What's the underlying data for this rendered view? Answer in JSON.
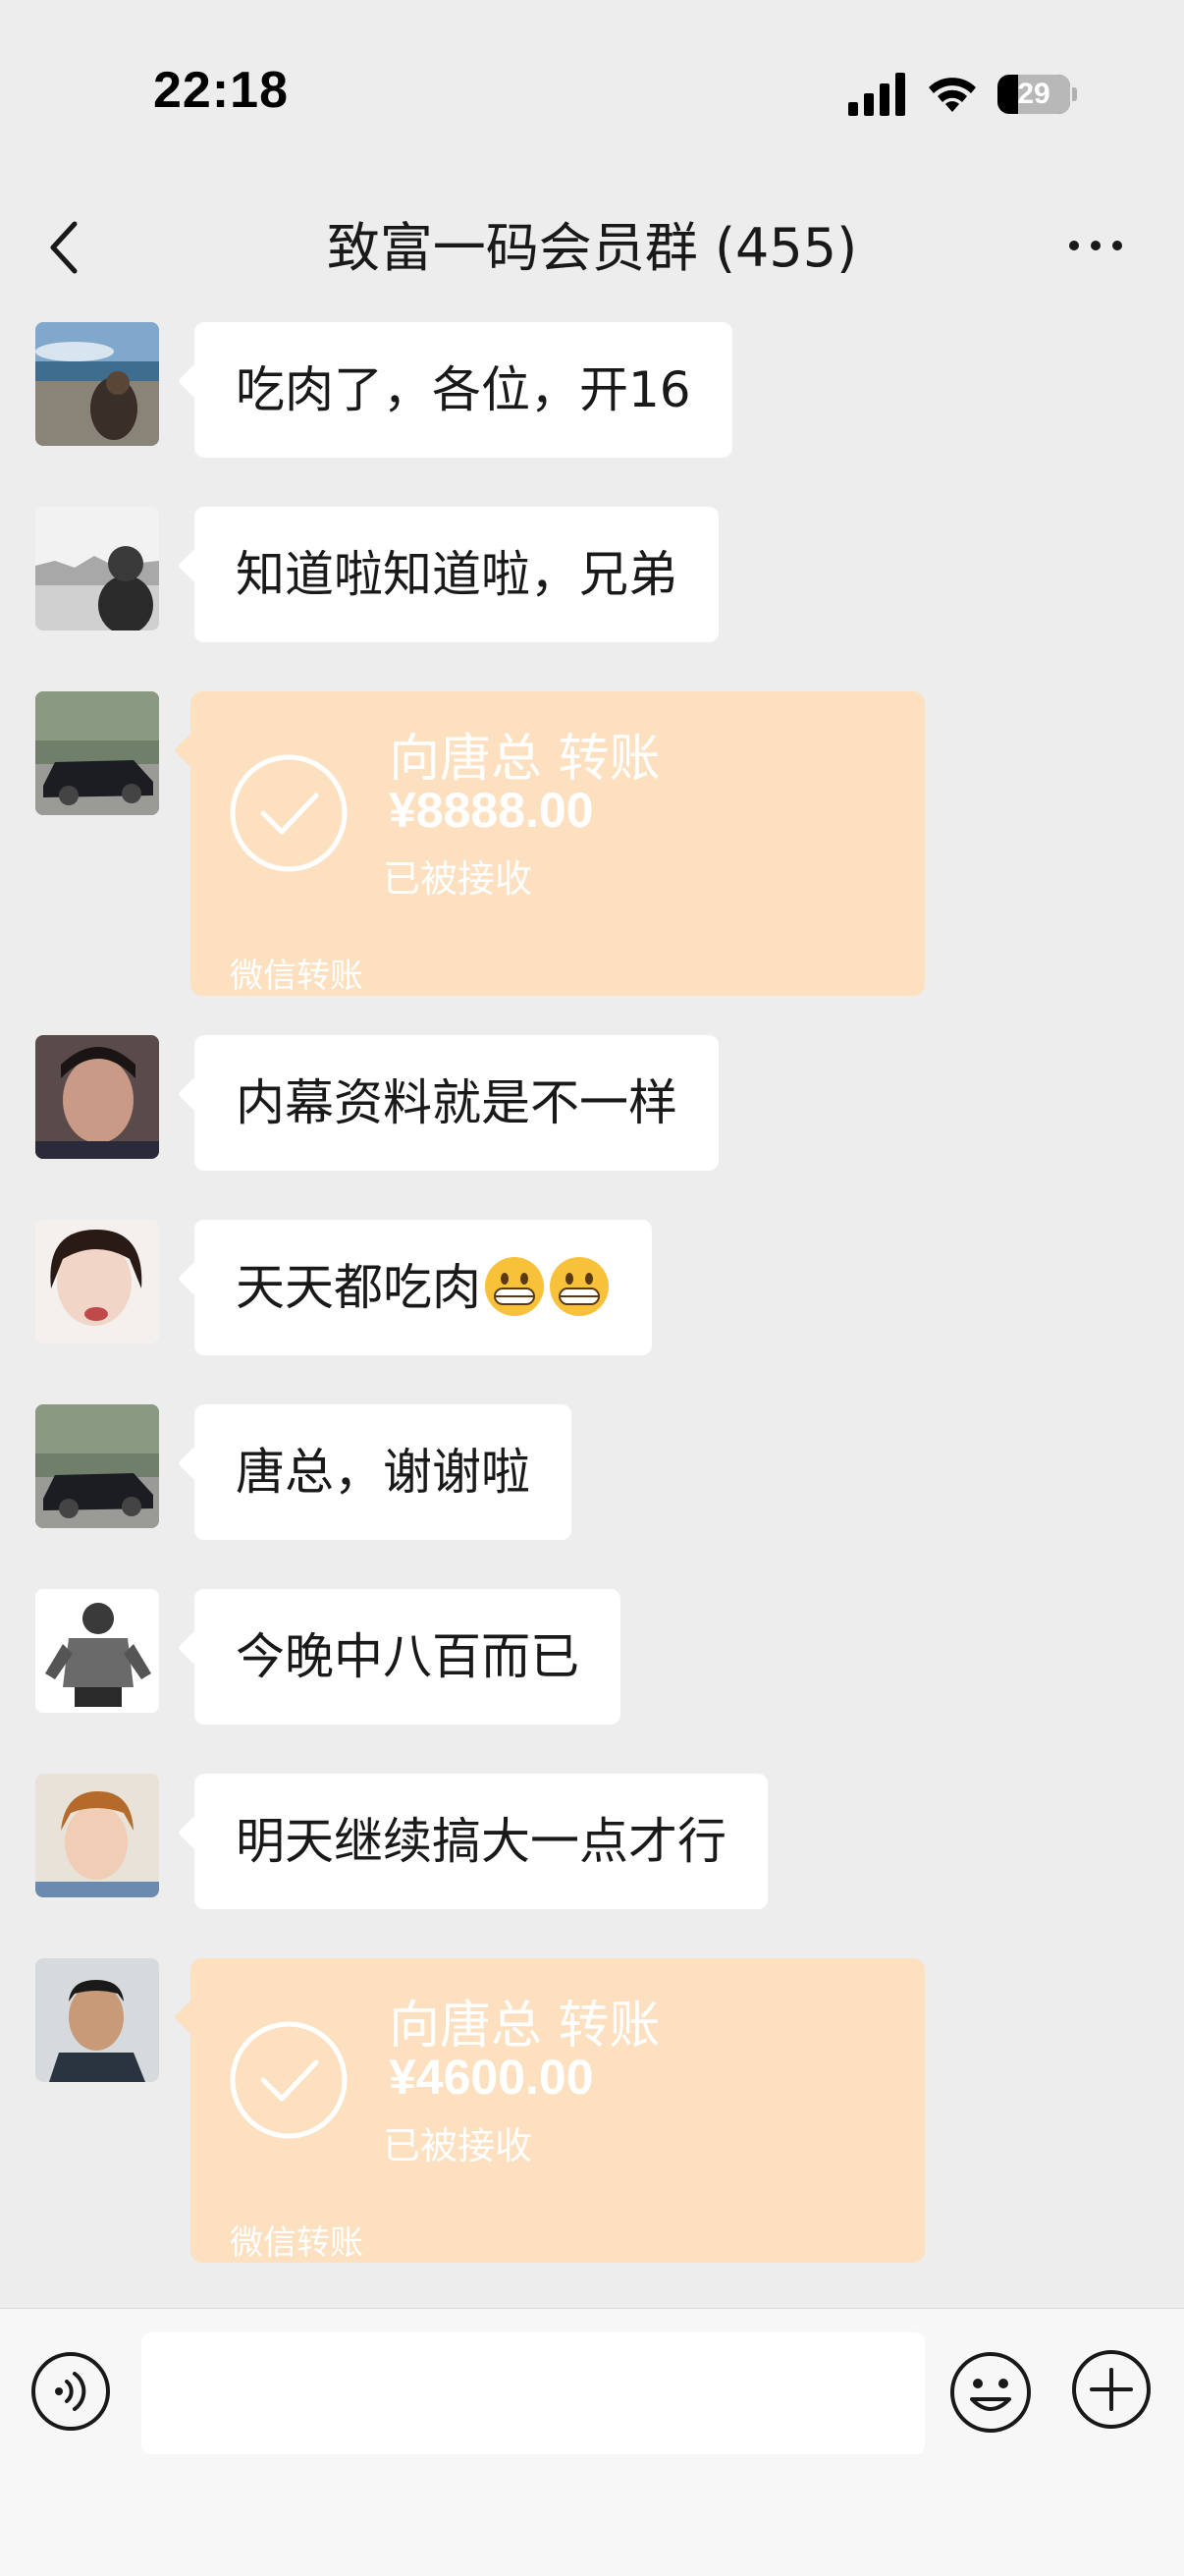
{
  "status_bar": {
    "time": "22:18",
    "battery_level": "29",
    "battery_fraction": 0.29
  },
  "header": {
    "title": "致富一码会员群 (455)",
    "back_icon": "chevron-left-icon",
    "more_icon": "ellipsis-icon"
  },
  "messages": [
    {
      "type": "text",
      "text": "吃肉了，各位，开16"
    },
    {
      "type": "text",
      "text": "知道啦知道啦，兄弟"
    },
    {
      "type": "transfer",
      "to": "向唐总 转账",
      "amount": "¥8888.00",
      "status": "已被接收",
      "footer": "微信转账"
    },
    {
      "type": "text",
      "text": "内幕资料就是不一样"
    },
    {
      "type": "text",
      "text": "天天都吃肉",
      "emojis": [
        "grinning-face-emoji",
        "grinning-face-emoji"
      ]
    },
    {
      "type": "text",
      "text": "唐总，谢谢啦"
    },
    {
      "type": "text",
      "text": "今晚中八百而已"
    },
    {
      "type": "text",
      "text": "明天继续搞大一点才行"
    },
    {
      "type": "transfer",
      "to": "向唐总 转账",
      "amount": "¥4600.00",
      "status": "已被接收",
      "footer": "微信转账"
    }
  ],
  "input_bar": {
    "voice_icon": "voice-icon",
    "text_value": "",
    "emoji_icon": "emoji-icon",
    "plus_icon": "plus-icon"
  },
  "colors": {
    "background": "#ededed",
    "bubble": "#ffffff",
    "transfer": "#fde0c0",
    "text": "#191919"
  }
}
